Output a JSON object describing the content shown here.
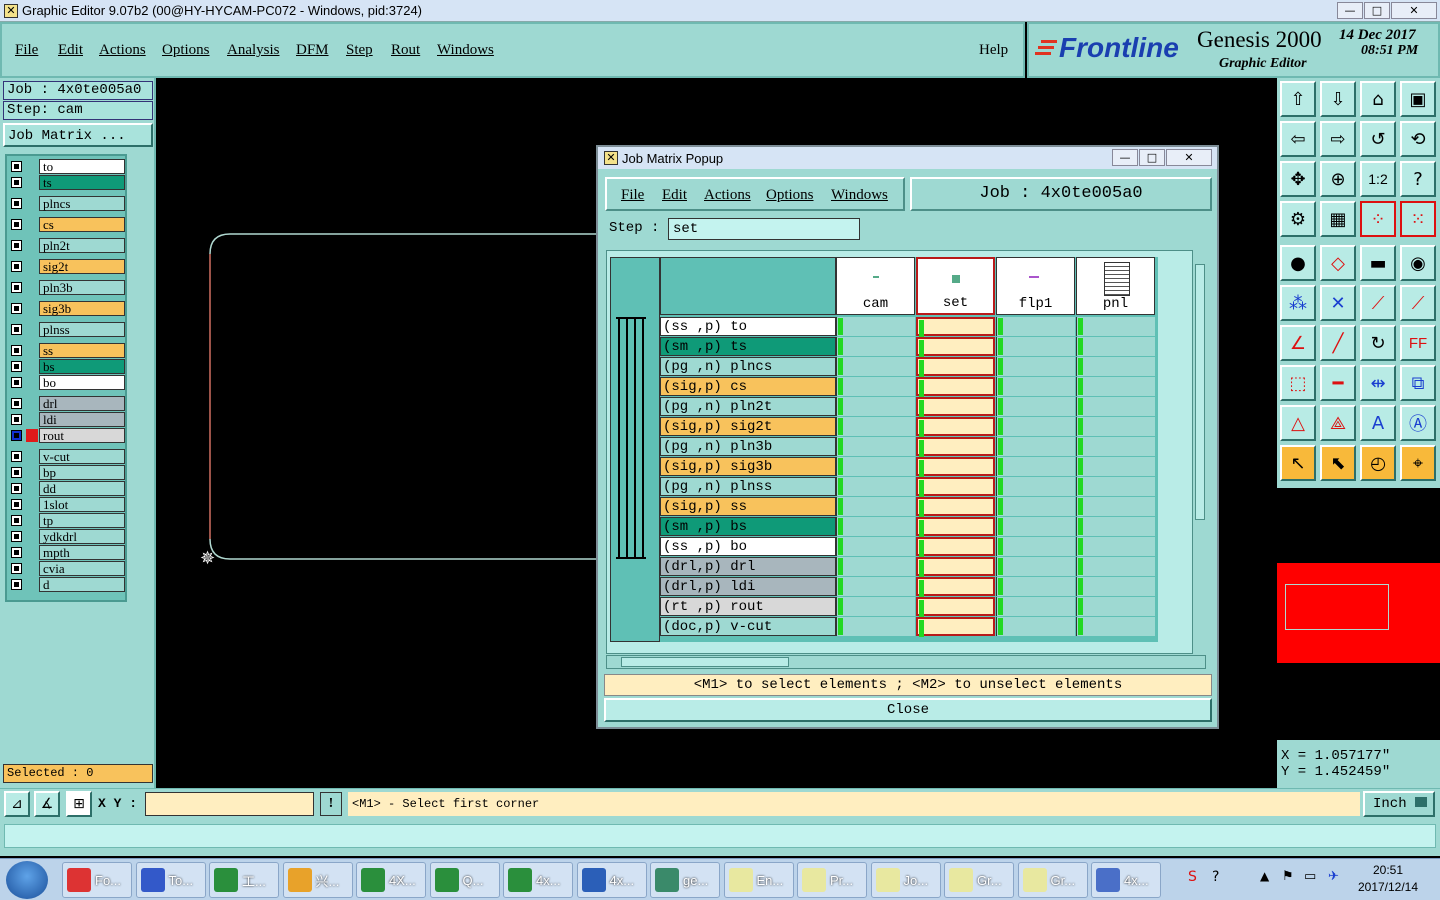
{
  "window": {
    "title": "Graphic Editor 9.07b2 (00@HY-HYCAM-PC072 - Windows, pid:3724)",
    "min": "—",
    "max": "□",
    "close": "✕"
  },
  "menu": [
    "File",
    "Edit",
    "Actions",
    "Options",
    "Analysis",
    "DFM",
    "Step",
    "Rout",
    "Windows"
  ],
  "help": "Help",
  "brand": {
    "logo": "Frontline",
    "product": "Genesis 2000",
    "subtitle": "Graphic Editor",
    "date": "14 Dec 2017",
    "time": "08:51 PM"
  },
  "left": {
    "job": "Job : 4x0te005a0",
    "step": "Step: cam",
    "job_matrix": "Job Matrix ...",
    "selected": "Selected : 0",
    "layers": [
      {
        "name": "to",
        "color": "#ffffff"
      },
      {
        "name": "ts",
        "color": "#0f9a78"
      },
      {
        "name": "plncs",
        "color": "#9ed9d2"
      },
      {
        "name": "cs",
        "color": "#f8c25c"
      },
      {
        "name": "pln2t",
        "color": "#9ed9d2"
      },
      {
        "name": "sig2t",
        "color": "#f8c25c"
      },
      {
        "name": "pln3b",
        "color": "#9ed9d2"
      },
      {
        "name": "sig3b",
        "color": "#f8c25c"
      },
      {
        "name": "plnss",
        "color": "#9ed9d2"
      },
      {
        "name": "ss",
        "color": "#f8c25c"
      },
      {
        "name": "bs",
        "color": "#0f9a78"
      },
      {
        "name": "bo",
        "color": "#ffffff"
      },
      {
        "name": "drl",
        "color": "#a8b6bd"
      },
      {
        "name": "ldi",
        "color": "#a8b6bd"
      },
      {
        "name": "rout",
        "color": "#d8d8d8"
      },
      {
        "name": "v-cut",
        "color": "#9ed9d2"
      },
      {
        "name": "bp",
        "color": "#9ed9d2"
      },
      {
        "name": "dd",
        "color": "#9ed9d2"
      },
      {
        "name": "1slot",
        "color": "#9ed9d2"
      },
      {
        "name": "tp",
        "color": "#9ed9d2"
      },
      {
        "name": "ydkdrl",
        "color": "#9ed9d2"
      },
      {
        "name": "mpth",
        "color": "#9ed9d2"
      },
      {
        "name": "cvia",
        "color": "#9ed9d2"
      },
      {
        "name": "d",
        "color": "#9ed9d2"
      }
    ]
  },
  "coords": {
    "x": "X = 1.057177\"",
    "y": "Y = 1.452459\""
  },
  "bottom": {
    "xy_label": "X Y :",
    "xy_value": "",
    "exclaim": "!",
    "prompt": "<M1> - Select first corner",
    "units": "Inch"
  },
  "popup": {
    "title": "Job Matrix Popup",
    "menu": [
      "File",
      "Edit",
      "Actions",
      "Options",
      "Windows"
    ],
    "job": "Job : 4x0te005a0",
    "step_label": "Step :",
    "step_value": "set",
    "columns": [
      "cam",
      "set",
      "flp1",
      "pnl"
    ],
    "rows": [
      {
        "label": "(ss ,p) to",
        "color": "#ffffff"
      },
      {
        "label": "(sm ,p) ts",
        "color": "#0f9a78"
      },
      {
        "label": "(pg ,n) plncs",
        "color": "#9ed9d2"
      },
      {
        "label": "(sig,p) cs",
        "color": "#f8c25c"
      },
      {
        "label": "(pg ,n) pln2t",
        "color": "#9ed9d2"
      },
      {
        "label": "(sig,p) sig2t",
        "color": "#f8c25c"
      },
      {
        "label": "(pg ,n) pln3b",
        "color": "#9ed9d2"
      },
      {
        "label": "(sig,p) sig3b",
        "color": "#f8c25c"
      },
      {
        "label": "(pg ,n) plnss",
        "color": "#9ed9d2"
      },
      {
        "label": "(sig,p) ss",
        "color": "#f8c25c"
      },
      {
        "label": "(sm ,p) bs",
        "color": "#0f9a78"
      },
      {
        "label": "(ss ,p) bo",
        "color": "#ffffff"
      },
      {
        "label": "(drl,p) drl",
        "color": "#a8b6bd"
      },
      {
        "label": "(drl,p) ldi",
        "color": "#a8b6bd"
      },
      {
        "label": "(rt ,p) rout",
        "color": "#d8d8d8"
      },
      {
        "label": "(doc,p) v-cut",
        "color": "#9ed9d2"
      }
    ],
    "hint": "<M1> to select elements ; <M2> to unselect elements",
    "close": "Close"
  },
  "taskbar": {
    "items": [
      "Fo...",
      "To...",
      "工...",
      "兴...",
      "4X...",
      "Q...",
      "4x...",
      "4x...",
      "ge...",
      "En...",
      "Pr...",
      "Jo...",
      "Gr...",
      "Gr...",
      "4x..."
    ],
    "clock_time": "20:51",
    "clock_date": "2017/12/14"
  }
}
